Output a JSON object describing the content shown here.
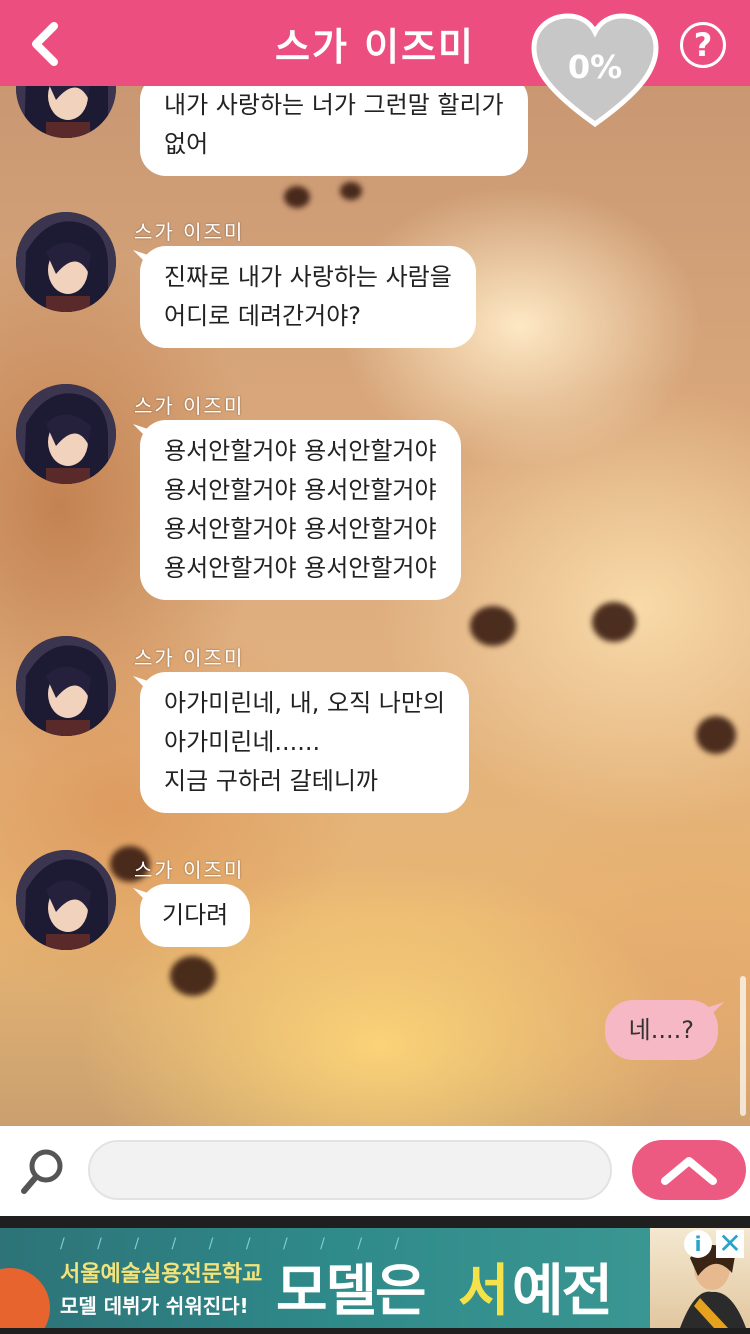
{
  "header": {
    "title": "스가 이즈미",
    "affinity_percent": "0%",
    "help_label": "?"
  },
  "messages": [
    {
      "sender": "",
      "lines": [
        "내가 사랑하는 너가 그런말 할리가",
        "없어"
      ]
    },
    {
      "sender": "스가 이즈미",
      "lines": [
        "진짜로 내가 사랑하는 사람을",
        "어디로 데려간거야?"
      ]
    },
    {
      "sender": "스가 이즈미",
      "lines": [
        "용서안할거야 용서안할거야",
        "용서안할거야 용서안할거야",
        "용서안할거야 용서안할거야",
        "용서안할거야 용서안할거야"
      ]
    },
    {
      "sender": "스가 이즈미",
      "lines": [
        "아가미린네, 내, 오직 나만의",
        "아가미린네......",
        "지금 구하러 갈테니까"
      ]
    },
    {
      "sender": "스가 이즈미",
      "lines": [
        "기다려"
      ]
    }
  ],
  "my_message": {
    "text": "네....?"
  },
  "input": {
    "value": "",
    "placeholder": ""
  },
  "ad": {
    "school": "서울예술실용전문학교",
    "tagline": "모델 데뷔가 쉬워진다!",
    "headline_a": "모델은",
    "headline_b": "서",
    "headline_c": "예전",
    "info_label": "i",
    "close_label": "✕"
  },
  "colors": {
    "accent": "#ec4f7f",
    "my_bubble": "#f7b8c6",
    "send_button": "#ec5a82"
  },
  "icons": {
    "back": "chevron-left-icon",
    "help": "question-circle-icon",
    "heart": "heart-icon",
    "search": "search-icon",
    "send": "chevron-up-icon"
  }
}
